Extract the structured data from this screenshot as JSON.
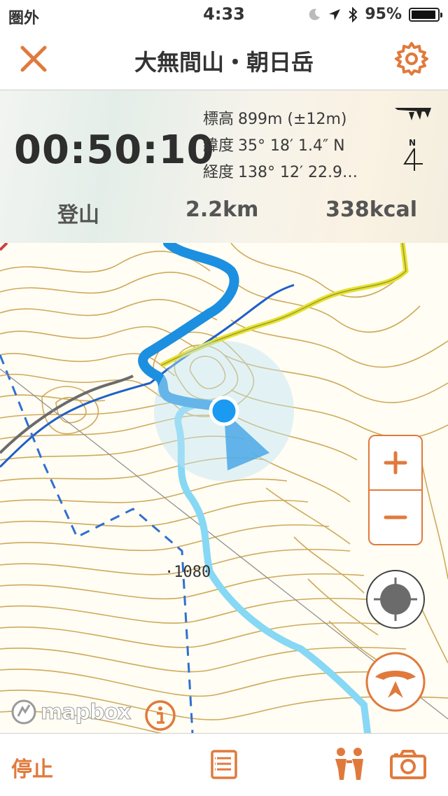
{
  "status_bar": {
    "carrier": "圏外",
    "time": "4:33",
    "battery": "95%",
    "battery_level": 0.95
  },
  "nav": {
    "title": "大無間山・朝日岳"
  },
  "stats": {
    "elapsed": "00:50:10",
    "elevation_label": "標高",
    "elevation_value": "899m (±12m)",
    "latitude_label": "緯度",
    "latitude_value": "35° 18′ 1.4″ N",
    "longitude_label": "経度",
    "longitude_value": "138° 12′ 22.9…",
    "compass_letter": "N",
    "activity": "登山",
    "distance": "2.2km",
    "calories": "338kcal"
  },
  "map": {
    "elevation_marker": "·1080",
    "attribution": "mapbox",
    "zoom_in": "+",
    "zoom_out": "−",
    "colors": {
      "contour": "#c9a247",
      "track": "#7fd6f5",
      "route": "#1e8fe0",
      "trail": "#e6e62a",
      "accent": "#e07a3c"
    }
  },
  "tab_bar": {
    "stop": "停止"
  },
  "icons": [
    "close-icon",
    "gear-icon",
    "signal-icon",
    "compass-icon",
    "plus-icon",
    "minus-icon",
    "locate-icon",
    "heading-icon",
    "info-icon",
    "list-icon",
    "people-icon",
    "camera-icon",
    "moon-icon",
    "location-arrow-icon",
    "bluetooth-icon"
  ]
}
